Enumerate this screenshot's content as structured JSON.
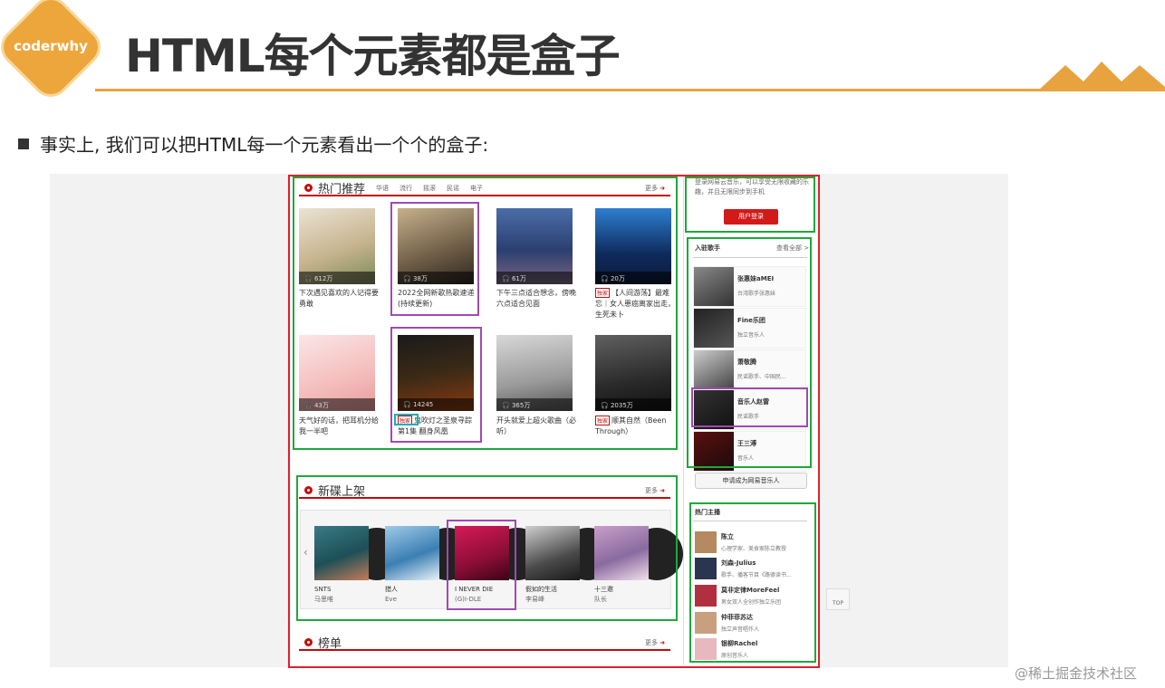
{
  "slide": {
    "logo_text": "coderwhy",
    "title": "HTML每个元素都是盒子",
    "bullet": "事实上, 我们可以把HTML每一个元素看出一个个的盒子:",
    "watermark": "@稀土掘金技术社区",
    "accent_color": "#e8a33e"
  },
  "hot": {
    "title": "热门推荐",
    "tags": [
      "华语",
      "流行",
      "摇滚",
      "民谣",
      "电子"
    ],
    "more": "更多",
    "playlists": [
      {
        "plays": "612万",
        "caption": "下次遇见喜欢的人记得要勇敢",
        "badge": ""
      },
      {
        "plays": "38万",
        "caption": "2022全网新歌热歌速递(持续更新)",
        "badge": ""
      },
      {
        "plays": "61万",
        "caption": "下午三点适合想念，傍晚六点适合见面",
        "badge": ""
      },
      {
        "plays": "20万",
        "caption": "【人间游荡】最难忘｜女人患癌离家出走，生死未卜",
        "badge": "独家"
      },
      {
        "plays": "43万",
        "caption": "天气好的话，把耳机分给我一半吧",
        "badge": ""
      },
      {
        "plays": "14245",
        "caption": "鬼吹灯之圣泉寻踪 第1集 翻身风凰",
        "badge": "独家"
      },
      {
        "plays": "365万",
        "caption": "开头就爱上超火歌曲（必听）",
        "badge": ""
      },
      {
        "plays": "2035万",
        "caption": "顺其自然（Been Through）",
        "badge": "独家"
      }
    ]
  },
  "newdisc": {
    "title": "新碟上架",
    "more": "更多",
    "albums": [
      {
        "name": "SNTS",
        "artist": "马思唯"
      },
      {
        "name": "猎人",
        "artist": "Eve"
      },
      {
        "name": "I NEVER DIE",
        "artist": "(G)I-DLE"
      },
      {
        "name": "假如的生活",
        "artist": "李易峰"
      },
      {
        "name": "十三邀",
        "artist": "队长"
      }
    ]
  },
  "toplist": {
    "title": "榜单",
    "more": "更多"
  },
  "login": {
    "text": "登录网易云音乐，可以享受无限收藏的乐趣，并且无限同步到手机",
    "button": "用户登录"
  },
  "singers": {
    "title": "入驻歌手",
    "more": "查看全部 >",
    "items": [
      {
        "name": "张惠妹aMEI",
        "desc": "台湾歌手张惠妹"
      },
      {
        "name": "Fine乐团",
        "desc": "独立音乐人"
      },
      {
        "name": "萧敬腾",
        "desc": "民谣歌手、中国民..."
      },
      {
        "name": "音乐人赵雷",
        "desc": "民谣歌手"
      },
      {
        "name": "王三溥",
        "desc": "音乐人"
      }
    ],
    "apply": "申请成为网易音乐人"
  },
  "anchors": {
    "title": "热门主播",
    "items": [
      {
        "name": "陈立",
        "desc": "心理学家、美食家陈立教授"
      },
      {
        "name": "刘森-Julius",
        "desc": "歌手、播客节目《路德读书..."
      },
      {
        "name": "莫非定律MoreFeel",
        "desc": "男女双人全创作独立乐团"
      },
      {
        "name": "仲菲菲苏达",
        "desc": "独立声音唱作人"
      },
      {
        "name": "银柳Rachel",
        "desc": "原创音乐人"
      }
    ]
  },
  "top_button": "TOP"
}
